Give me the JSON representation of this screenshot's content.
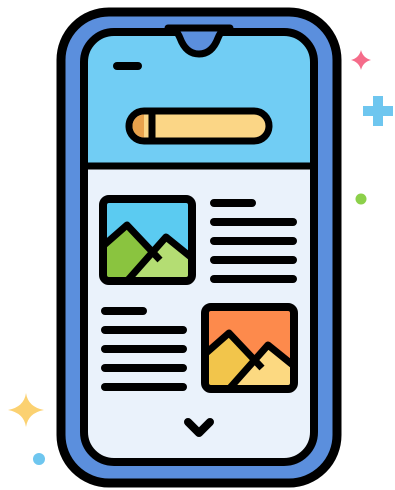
{
  "illustration": {
    "subject": "smartphone-with-article-layout-icon",
    "colors": {
      "outline": "#000000",
      "phone_body": "#5b8fdd",
      "screen_bg": "#eaf2fb",
      "header_bg": "#71cdf4",
      "search_bar_fill": "#fbd686",
      "search_bar_cap": "#e9a24c",
      "image1_sky": "#5bcbf1",
      "image1_mountain_back": "#8ac43f",
      "image1_mountain_front": "#b4dd73",
      "image2_sky": "#fd8a4c",
      "image2_mountain_back": "#f2c54b",
      "image2_mountain_front": "#fcd981",
      "sparkle_pink": "#f56c8a",
      "sparkle_blue": "#6ec6ef",
      "sparkle_yellow": "#fbd171",
      "dot_green": "#8cd04a",
      "dot_blue": "#6ec6ef"
    },
    "icons": [
      "phone-icon",
      "image-placeholder-icon",
      "chevron-down-icon",
      "sparkle-icon",
      "plus-icon"
    ]
  }
}
